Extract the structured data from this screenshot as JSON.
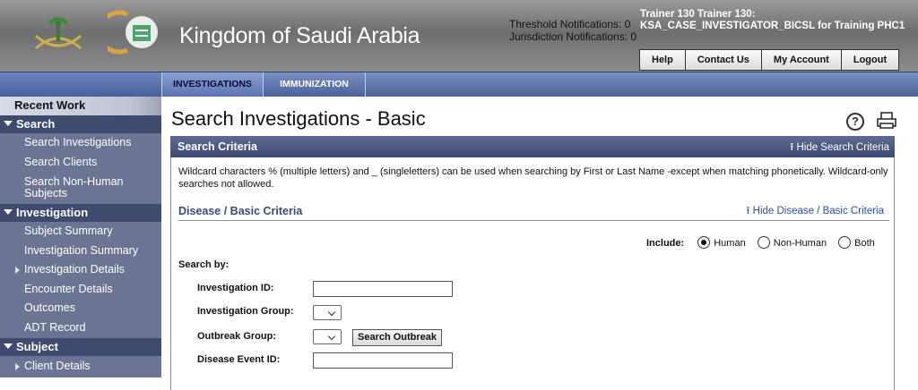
{
  "header": {
    "title": "Kingdom of Saudi Arabia",
    "threshold_notifications": "Threshold Notifications: 0",
    "jurisdiction_notifications": "Jurisdiction Notifications: 0",
    "user": "Trainer 130 Trainer 130: KSA_CASE_INVESTIGATOR_BICSL for Training PHC1",
    "buttons": [
      "Help",
      "Contact Us",
      "My Account",
      "Logout"
    ]
  },
  "tabs": [
    "INVESTIGATIONS",
    "IMMUNIZATION"
  ],
  "sidebar": {
    "recent": "Recent Work",
    "search_section": "Search",
    "search_items": [
      "Search Investigations",
      "Search Clients",
      "Search Non-Human Subjects"
    ],
    "investigation_section": "Investigation",
    "investigation_items": [
      "Subject Summary",
      "Investigation Summary",
      "Investigation Details",
      "Encounter Details",
      "Outcomes",
      "ADT Record"
    ],
    "subject_section": "Subject",
    "subject_items": [
      "Client Details"
    ]
  },
  "main": {
    "page_title": "Search Investigations - Basic",
    "criteria_title": "Search Criteria",
    "hide_criteria": "Hide Search Criteria",
    "wildcard_note": "Wildcard characters % (multiple letters) and _ (singleletters) can be used when searching by First or Last Name -except when matching phonetically. Wildcard-only searches not allowed.",
    "disease_title": "Disease / Basic Criteria",
    "hide_disease": "Hide Disease / Basic Criteria",
    "include_label": "Include:",
    "include_options": [
      "Human",
      "Non-Human",
      "Both"
    ],
    "include_selected": "Human",
    "search_by": "Search by:",
    "fields": {
      "investigation_id": "Investigation ID:",
      "investigation_group": "Investigation Group:",
      "outbreak_group": "Outbreak Group:",
      "disease_event_id": "Disease Event ID:"
    },
    "search_outbreak_btn": "Search Outbreak"
  },
  "colors": {
    "header_gray": "#7a7a7a",
    "tab_blue": "#5a73b2",
    "sidebar_bg": "#6b7593",
    "section_bg": "#3f4a6e",
    "criteria_bar": "#4b5880"
  },
  "icons": [
    "saudi-emblem-icon",
    "ministry-logo-icon",
    "help-icon",
    "print-icon",
    "collapse-up-icon",
    "collapse-triangle-icon",
    "expand-arrow-icon"
  ]
}
